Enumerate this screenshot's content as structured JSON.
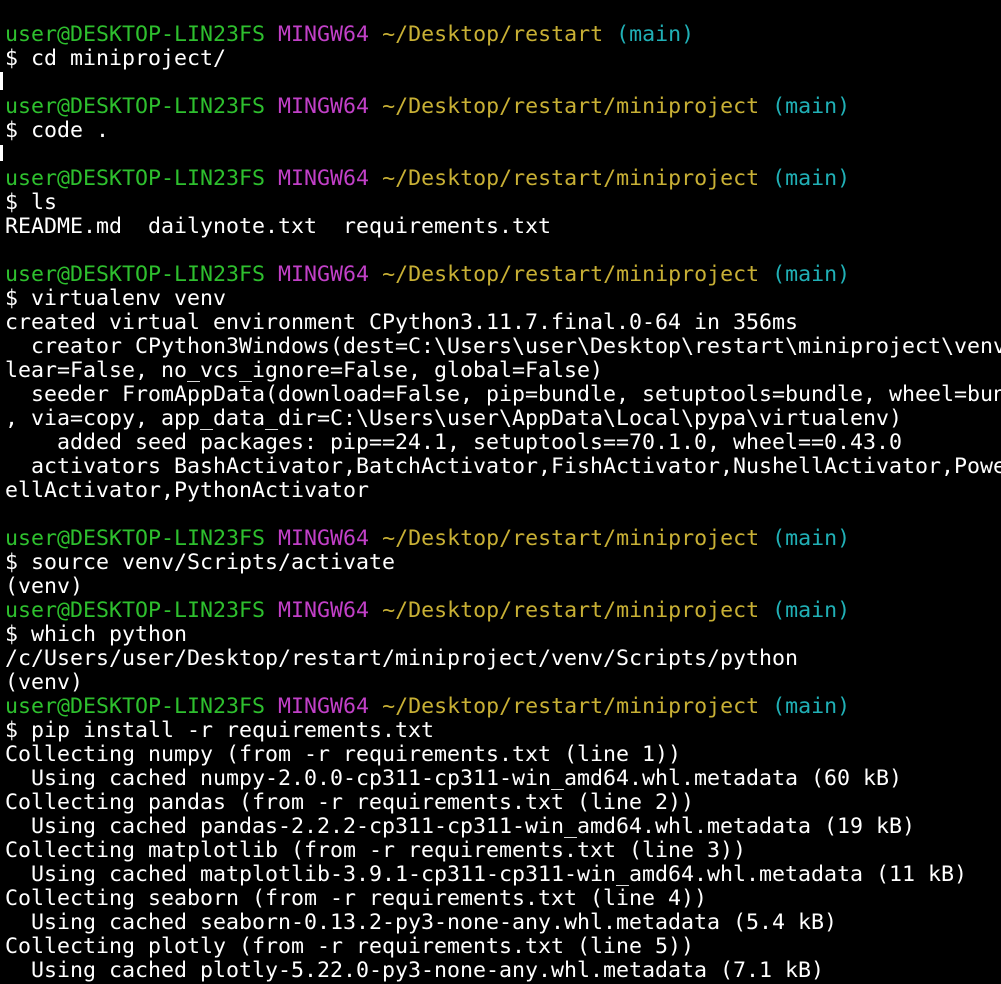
{
  "colors": {
    "background": "#000000",
    "text": "#ffffff",
    "user": "#2ec02e",
    "system": "#c240c8",
    "path": "#c8b035",
    "branch": "#20b0b6"
  },
  "lines": [
    {
      "kind": "prompt",
      "user": "user@DESKTOP-LIN23FS",
      "sys": "MINGW64",
      "path": "~/Desktop/restart",
      "branch": "(main)"
    },
    {
      "kind": "text",
      "text": "$ cd miniproject/"
    },
    {
      "kind": "blank"
    },
    {
      "kind": "prompt",
      "user": "user@DESKTOP-LIN23FS",
      "sys": "MINGW64",
      "path": "~/Desktop/restart/miniproject",
      "branch": "(main)"
    },
    {
      "kind": "text",
      "text": "$ code ."
    },
    {
      "kind": "blank"
    },
    {
      "kind": "prompt",
      "user": "user@DESKTOP-LIN23FS",
      "sys": "MINGW64",
      "path": "~/Desktop/restart/miniproject",
      "branch": "(main)"
    },
    {
      "kind": "text",
      "text": "$ ls"
    },
    {
      "kind": "text",
      "text": "README.md  dailynote.txt  requirements.txt"
    },
    {
      "kind": "blank"
    },
    {
      "kind": "prompt",
      "user": "user@DESKTOP-LIN23FS",
      "sys": "MINGW64",
      "path": "~/Desktop/restart/miniproject",
      "branch": "(main)"
    },
    {
      "kind": "text",
      "text": "$ virtualenv venv"
    },
    {
      "kind": "text",
      "text": "created virtual environment CPython3.11.7.final.0-64 in 356ms"
    },
    {
      "kind": "text",
      "text": "  creator CPython3Windows(dest=C:\\Users\\user\\Desktop\\restart\\miniproject\\venv"
    },
    {
      "kind": "text",
      "text": "lear=False, no_vcs_ignore=False, global=False)"
    },
    {
      "kind": "text",
      "text": "  seeder FromAppData(download=False, pip=bundle, setuptools=bundle, wheel=bun"
    },
    {
      "kind": "text",
      "text": ", via=copy, app_data_dir=C:\\Users\\user\\AppData\\Local\\pypa\\virtualenv)"
    },
    {
      "kind": "text",
      "text": "    added seed packages: pip==24.1, setuptools==70.1.0, wheel==0.43.0"
    },
    {
      "kind": "text",
      "text": "  activators BashActivator,BatchActivator,FishActivator,NushellActivator,Powe"
    },
    {
      "kind": "text",
      "text": "ellActivator,PythonActivator"
    },
    {
      "kind": "blank"
    },
    {
      "kind": "prompt",
      "user": "user@DESKTOP-LIN23FS",
      "sys": "MINGW64",
      "path": "~/Desktop/restart/miniproject",
      "branch": "(main)"
    },
    {
      "kind": "text",
      "text": "$ source venv/Scripts/activate"
    },
    {
      "kind": "text",
      "text": "(venv)"
    },
    {
      "kind": "prompt",
      "user": "user@DESKTOP-LIN23FS",
      "sys": "MINGW64",
      "path": "~/Desktop/restart/miniproject",
      "branch": "(main)"
    },
    {
      "kind": "text",
      "text": "$ which python"
    },
    {
      "kind": "text",
      "text": "/c/Users/user/Desktop/restart/miniproject/venv/Scripts/python"
    },
    {
      "kind": "text",
      "text": "(venv)"
    },
    {
      "kind": "prompt",
      "user": "user@DESKTOP-LIN23FS",
      "sys": "MINGW64",
      "path": "~/Desktop/restart/miniproject",
      "branch": "(main)"
    },
    {
      "kind": "text",
      "text": "$ pip install -r requirements.txt"
    },
    {
      "kind": "text",
      "text": "Collecting numpy (from -r requirements.txt (line 1))"
    },
    {
      "kind": "text",
      "text": "  Using cached numpy-2.0.0-cp311-cp311-win_amd64.whl.metadata (60 kB)"
    },
    {
      "kind": "text",
      "text": "Collecting pandas (from -r requirements.txt (line 2))"
    },
    {
      "kind": "text",
      "text": "  Using cached pandas-2.2.2-cp311-cp311-win_amd64.whl.metadata (19 kB)"
    },
    {
      "kind": "text",
      "text": "Collecting matplotlib (from -r requirements.txt (line 3))"
    },
    {
      "kind": "text",
      "text": "  Using cached matplotlib-3.9.1-cp311-cp311-win_amd64.whl.metadata (11 kB)"
    },
    {
      "kind": "text",
      "text": "Collecting seaborn (from -r requirements.txt (line 4))"
    },
    {
      "kind": "text",
      "text": "  Using cached seaborn-0.13.2-py3-none-any.whl.metadata (5.4 kB)"
    },
    {
      "kind": "text",
      "text": "Collecting plotly (from -r requirements.txt (line 5))"
    },
    {
      "kind": "text",
      "text": "  Using cached plotly-5.22.0-py3-none-any.whl.metadata (7.1 kB)"
    }
  ]
}
